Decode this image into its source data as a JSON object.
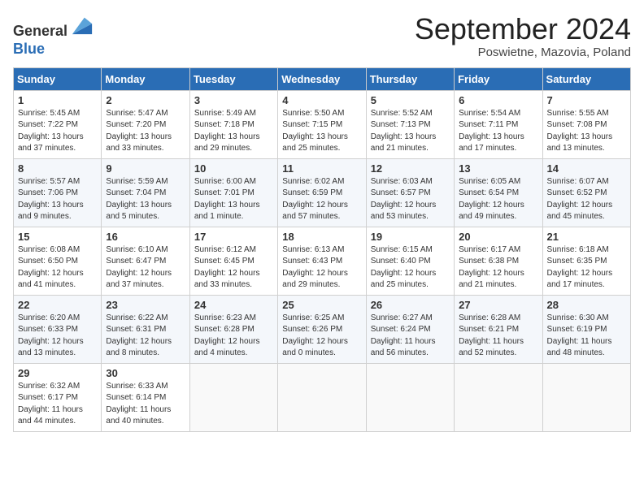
{
  "logo": {
    "general": "General",
    "blue": "Blue"
  },
  "header": {
    "month": "September 2024",
    "location": "Poswietne, Mazovia, Poland"
  },
  "weekdays": [
    "Sunday",
    "Monday",
    "Tuesday",
    "Wednesday",
    "Thursday",
    "Friday",
    "Saturday"
  ],
  "weeks": [
    [
      {
        "day": "1",
        "sunrise": "5:45 AM",
        "sunset": "7:22 PM",
        "daylight": "13 hours and 37 minutes."
      },
      {
        "day": "2",
        "sunrise": "5:47 AM",
        "sunset": "7:20 PM",
        "daylight": "13 hours and 33 minutes."
      },
      {
        "day": "3",
        "sunrise": "5:49 AM",
        "sunset": "7:18 PM",
        "daylight": "13 hours and 29 minutes."
      },
      {
        "day": "4",
        "sunrise": "5:50 AM",
        "sunset": "7:15 PM",
        "daylight": "13 hours and 25 minutes."
      },
      {
        "day": "5",
        "sunrise": "5:52 AM",
        "sunset": "7:13 PM",
        "daylight": "13 hours and 21 minutes."
      },
      {
        "day": "6",
        "sunrise": "5:54 AM",
        "sunset": "7:11 PM",
        "daylight": "13 hours and 17 minutes."
      },
      {
        "day": "7",
        "sunrise": "5:55 AM",
        "sunset": "7:08 PM",
        "daylight": "13 hours and 13 minutes."
      }
    ],
    [
      {
        "day": "8",
        "sunrise": "5:57 AM",
        "sunset": "7:06 PM",
        "daylight": "13 hours and 9 minutes."
      },
      {
        "day": "9",
        "sunrise": "5:59 AM",
        "sunset": "7:04 PM",
        "daylight": "13 hours and 5 minutes."
      },
      {
        "day": "10",
        "sunrise": "6:00 AM",
        "sunset": "7:01 PM",
        "daylight": "13 hours and 1 minute."
      },
      {
        "day": "11",
        "sunrise": "6:02 AM",
        "sunset": "6:59 PM",
        "daylight": "12 hours and 57 minutes."
      },
      {
        "day": "12",
        "sunrise": "6:03 AM",
        "sunset": "6:57 PM",
        "daylight": "12 hours and 53 minutes."
      },
      {
        "day": "13",
        "sunrise": "6:05 AM",
        "sunset": "6:54 PM",
        "daylight": "12 hours and 49 minutes."
      },
      {
        "day": "14",
        "sunrise": "6:07 AM",
        "sunset": "6:52 PM",
        "daylight": "12 hours and 45 minutes."
      }
    ],
    [
      {
        "day": "15",
        "sunrise": "6:08 AM",
        "sunset": "6:50 PM",
        "daylight": "12 hours and 41 minutes."
      },
      {
        "day": "16",
        "sunrise": "6:10 AM",
        "sunset": "6:47 PM",
        "daylight": "12 hours and 37 minutes."
      },
      {
        "day": "17",
        "sunrise": "6:12 AM",
        "sunset": "6:45 PM",
        "daylight": "12 hours and 33 minutes."
      },
      {
        "day": "18",
        "sunrise": "6:13 AM",
        "sunset": "6:43 PM",
        "daylight": "12 hours and 29 minutes."
      },
      {
        "day": "19",
        "sunrise": "6:15 AM",
        "sunset": "6:40 PM",
        "daylight": "12 hours and 25 minutes."
      },
      {
        "day": "20",
        "sunrise": "6:17 AM",
        "sunset": "6:38 PM",
        "daylight": "12 hours and 21 minutes."
      },
      {
        "day": "21",
        "sunrise": "6:18 AM",
        "sunset": "6:35 PM",
        "daylight": "12 hours and 17 minutes."
      }
    ],
    [
      {
        "day": "22",
        "sunrise": "6:20 AM",
        "sunset": "6:33 PM",
        "daylight": "12 hours and 13 minutes."
      },
      {
        "day": "23",
        "sunrise": "6:22 AM",
        "sunset": "6:31 PM",
        "daylight": "12 hours and 8 minutes."
      },
      {
        "day": "24",
        "sunrise": "6:23 AM",
        "sunset": "6:28 PM",
        "daylight": "12 hours and 4 minutes."
      },
      {
        "day": "25",
        "sunrise": "6:25 AM",
        "sunset": "6:26 PM",
        "daylight": "12 hours and 0 minutes."
      },
      {
        "day": "26",
        "sunrise": "6:27 AM",
        "sunset": "6:24 PM",
        "daylight": "11 hours and 56 minutes."
      },
      {
        "day": "27",
        "sunrise": "6:28 AM",
        "sunset": "6:21 PM",
        "daylight": "11 hours and 52 minutes."
      },
      {
        "day": "28",
        "sunrise": "6:30 AM",
        "sunset": "6:19 PM",
        "daylight": "11 hours and 48 minutes."
      }
    ],
    [
      {
        "day": "29",
        "sunrise": "6:32 AM",
        "sunset": "6:17 PM",
        "daylight": "11 hours and 44 minutes."
      },
      {
        "day": "30",
        "sunrise": "6:33 AM",
        "sunset": "6:14 PM",
        "daylight": "11 hours and 40 minutes."
      },
      null,
      null,
      null,
      null,
      null
    ]
  ]
}
